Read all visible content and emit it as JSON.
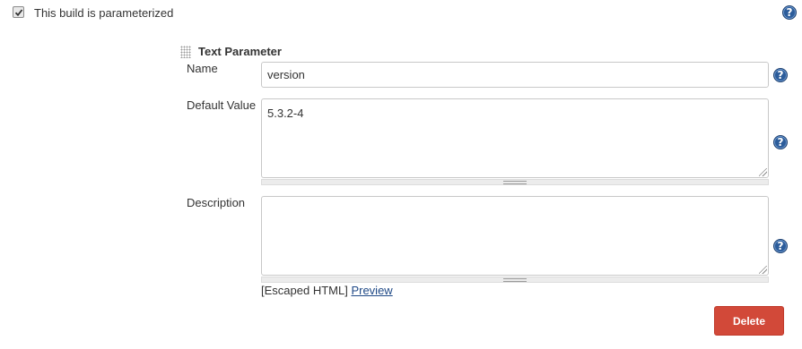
{
  "parameterized": {
    "label": "This build is parameterized",
    "checked": true
  },
  "parameter": {
    "type_title": "Text Parameter",
    "name_label": "Name",
    "name_value": "version",
    "default_label": "Default Value",
    "default_value": "5.3.2-4",
    "description_label": "Description",
    "description_value": "",
    "escaped_prefix": "[Escaped HTML]",
    "preview_link": "Preview"
  },
  "actions": {
    "delete_label": "Delete"
  },
  "help_glyph": "?",
  "colors": {
    "delete_button": "#d24939",
    "help_icon": "#2c5c9a",
    "link": "#204a87"
  }
}
